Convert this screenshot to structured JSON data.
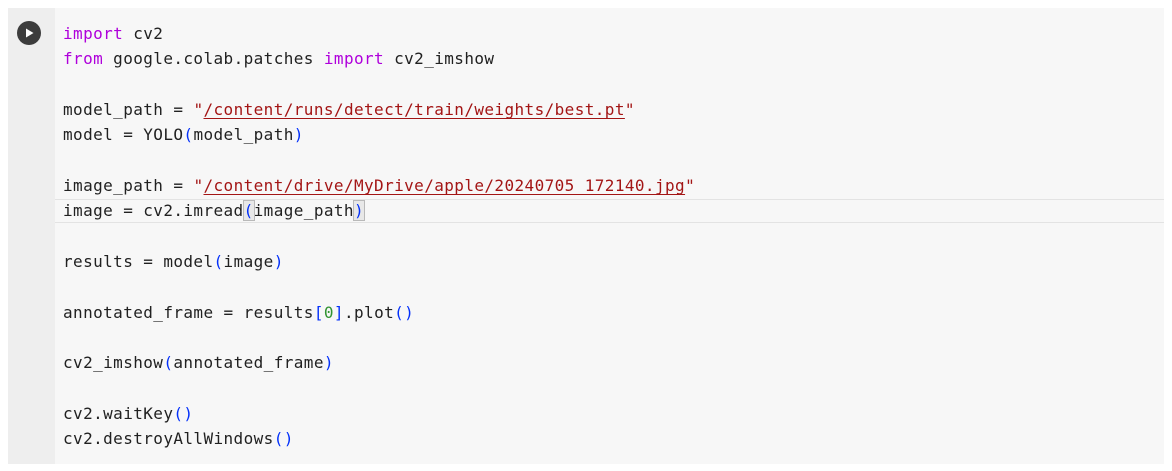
{
  "run_button": {
    "icon": "play-icon"
  },
  "code": {
    "l1_kw": "import",
    "l1_rest": " cv2",
    "l2_kw1": "from",
    "l2_mid": " google.colab.patches ",
    "l2_kw2": "import",
    "l2_rest": " cv2_imshow",
    "l3_lhs": "model_path = ",
    "l3_q1": "\"",
    "l3_str": "/content/runs/detect/train/weights/best.pt",
    "l3_q2": "\"",
    "l4_lhs": "model = YOLO",
    "l4_open": "(",
    "l4_arg": "model_path",
    "l4_close": ")",
    "l5_lhs": "image_path = ",
    "l5_q1": "\"",
    "l5_str": "/content/drive/MyDrive/apple/20240705_172140.jpg",
    "l5_q2": "\"",
    "l6_lhs": "image = cv2.imread",
    "l6_open": "(",
    "l6_arg": "image_path",
    "l6_close": ")",
    "l7_lhs": "results = model",
    "l7_open": "(",
    "l7_arg": "image",
    "l7_close": ")",
    "l8_lhs": "annotated_frame = results",
    "l8_open": "[",
    "l8_idx": "0",
    "l8_close": "]",
    "l8_mid": ".plot",
    "l8_call": "()",
    "l9_lhs": "cv2_imshow",
    "l9_open": "(",
    "l9_arg": "annotated_frame",
    "l9_close": ")",
    "l10_lhs": "cv2.waitKey",
    "l10_call": "()",
    "l11_lhs": "cv2.destroyAllWindows",
    "l11_call": "()"
  },
  "colors": {
    "keyword": "#af00db",
    "string": "#a31515",
    "bracket": "#0431fa",
    "bracket_inner": "#319331",
    "text": "#212121",
    "cell_background": "#f7f7f7",
    "gutter_background": "#eeeeee"
  }
}
